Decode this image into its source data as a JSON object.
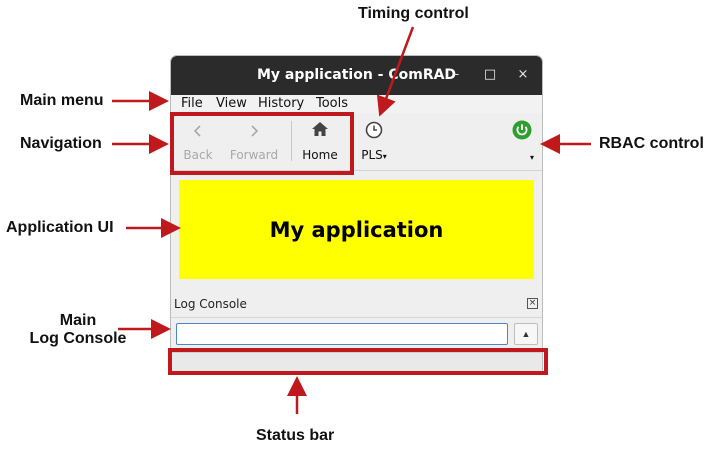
{
  "annotations": {
    "main_menu": "Main menu",
    "navigation": "Navigation",
    "application_ui": "Application UI",
    "main_log_console_line1": "Main",
    "main_log_console_line2": "Log Console",
    "timing_control": "Timing control",
    "rbac_control": "RBAC control",
    "status_bar": "Status bar"
  },
  "window": {
    "title": "My application - ComRAD",
    "minimize_glyph": "–",
    "maximize_glyph": "□",
    "close_glyph": "×"
  },
  "menu": {
    "items": [
      "File",
      "View",
      "History",
      "Tools"
    ]
  },
  "toolbar": {
    "back": {
      "label": "Back",
      "glyph": "‹"
    },
    "forward": {
      "label": "Forward",
      "glyph": "›"
    },
    "home": {
      "label": "Home"
    },
    "timing": {
      "label": "PLS",
      "dropdown_glyph": "▾"
    },
    "rbac": {
      "dropdown_glyph": "▾"
    }
  },
  "application": {
    "title": "My application"
  },
  "log_console": {
    "title": "Log Console",
    "close_glyph": "×",
    "input_value": "",
    "expand_glyph": "▲"
  },
  "status_bar": {
    "text": ""
  },
  "colors": {
    "title_bar": "#2b2b2b",
    "highlight": "#c0191d",
    "app_background": "#ffff00",
    "rbac_green": "#2e9e2e",
    "window_background": "#efefef",
    "input_border": "#4a86c8"
  },
  "icons": {
    "back": "chevron-left-icon",
    "forward": "chevron-right-icon",
    "home": "home-icon",
    "timing": "clock-icon",
    "rbac": "power-icon"
  }
}
